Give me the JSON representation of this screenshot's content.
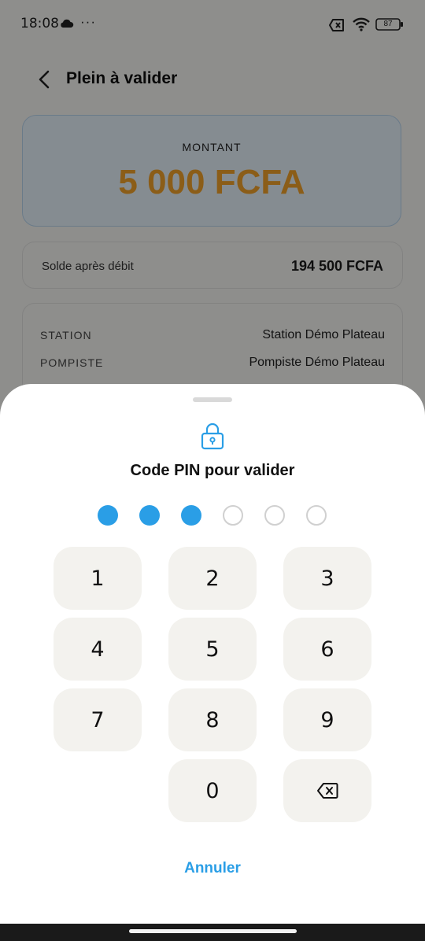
{
  "status_bar": {
    "time": "18:08",
    "more": "···",
    "battery": "87"
  },
  "header": {
    "title": "Plein à valider"
  },
  "amount": {
    "label": "MONTANT",
    "value": "5 000 FCFA"
  },
  "balance": {
    "label": "Solde après débit",
    "value": "194 500 FCFA"
  },
  "details": {
    "rows": [
      {
        "label": "STATION",
        "value": "Station Démo Plateau"
      },
      {
        "label": "POMPISTE",
        "value": "Pompiste Démo Plateau"
      }
    ]
  },
  "pin_sheet": {
    "title": "Code PIN pour valider",
    "digits_entered": 3,
    "digits_total": 6,
    "keys": [
      "1",
      "2",
      "3",
      "4",
      "5",
      "6",
      "7",
      "8",
      "9",
      "0"
    ],
    "cancel_label": "Annuler"
  },
  "colors": {
    "accent": "#2a9ee6",
    "amount": "#f0a02a"
  }
}
